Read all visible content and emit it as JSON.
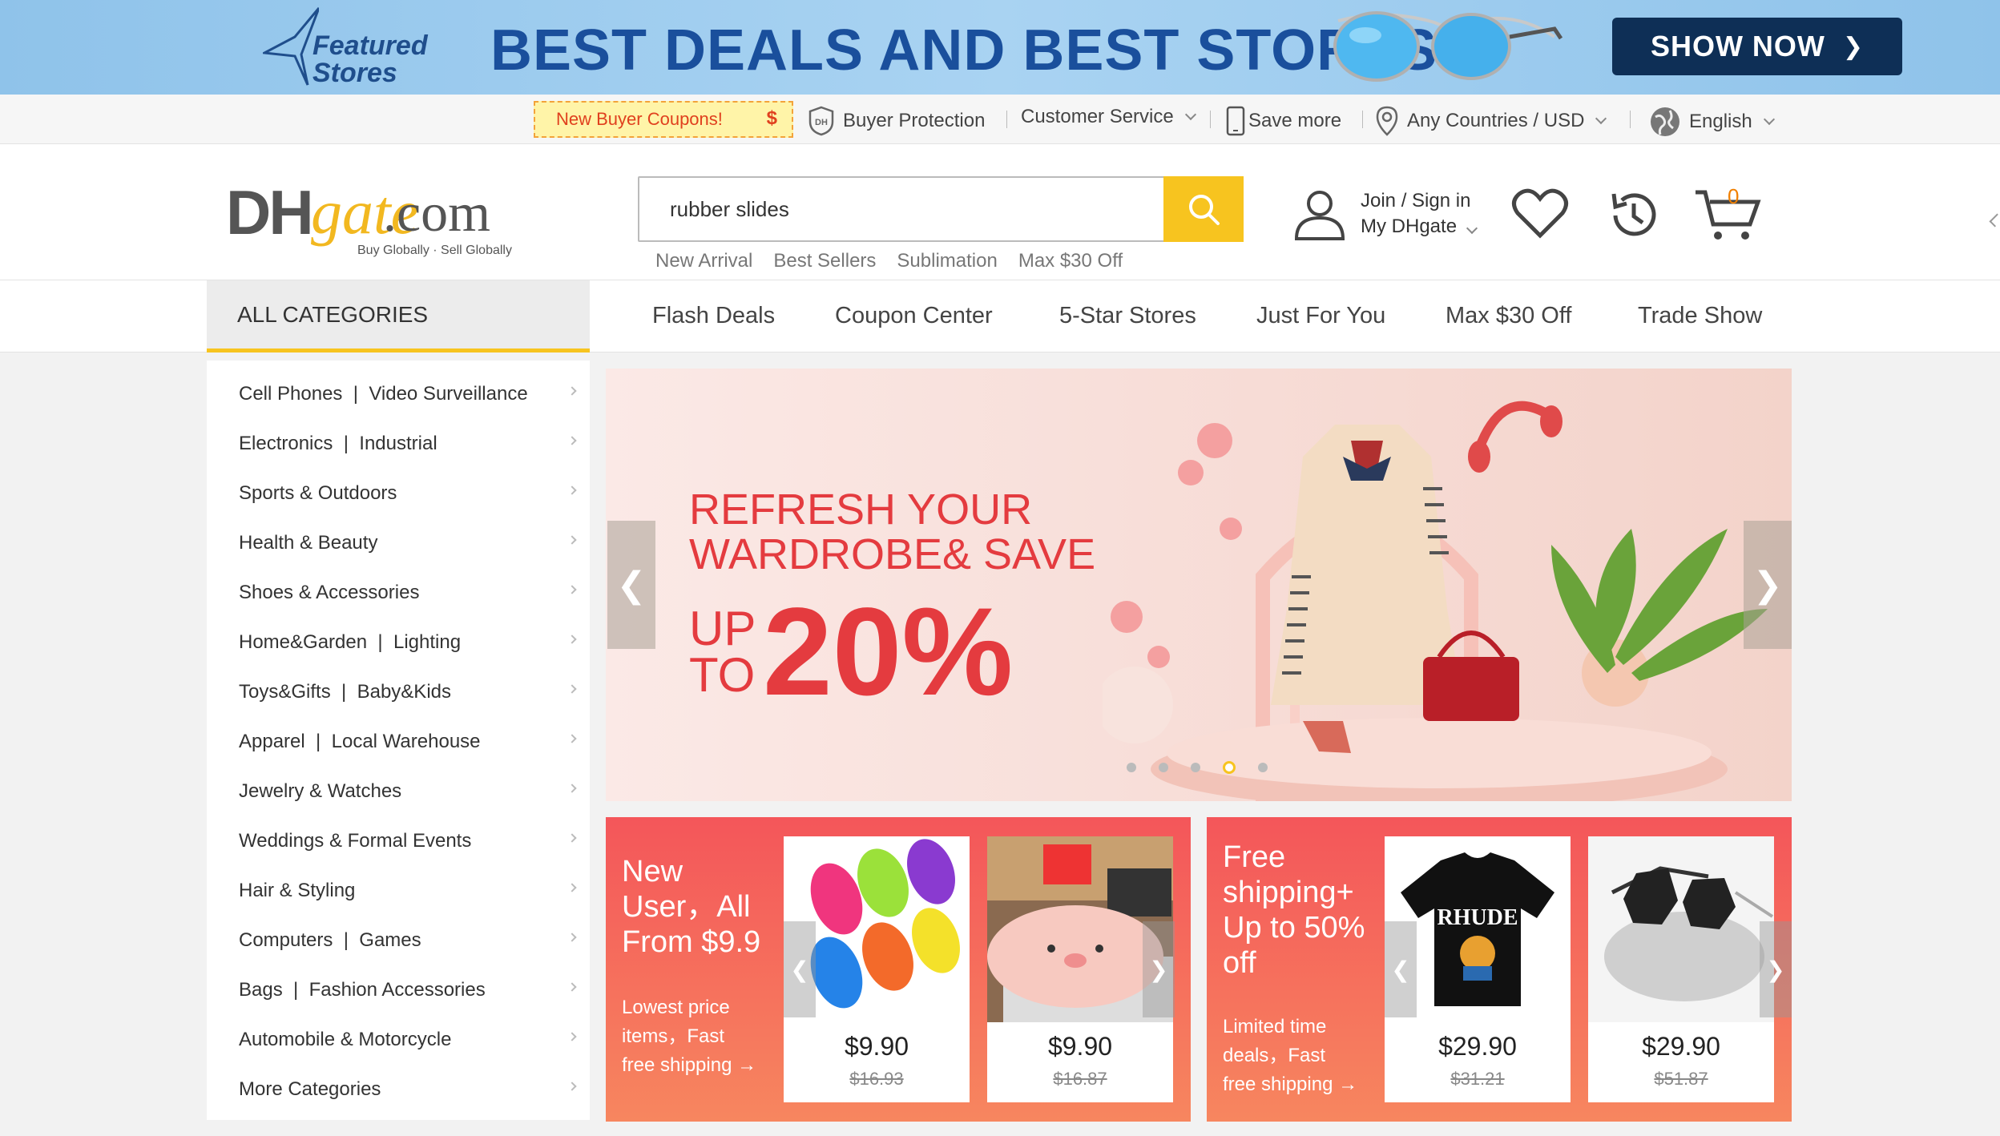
{
  "banner": {
    "featured_line1": "Featured",
    "featured_line2": "Stores",
    "title": "BEST DEALS AND BEST STORES",
    "cta": "SHOW NOW",
    "cta_icon": "chevron-right-icon"
  },
  "utility": {
    "coupon": "New Buyer Coupons!",
    "coupon_symbol": "$",
    "buyer_protection": "Buyer Protection",
    "customer_service": "Customer Service",
    "save_more": "Save more",
    "region": "Any Countries / USD",
    "language": "English"
  },
  "header": {
    "logo_dh": "DH",
    "logo_gate": "gate",
    "logo_com": ".com",
    "logo_tagline": "Buy Globally · Sell Globally",
    "search_value": "rubber slides",
    "hot_links": [
      "New Arrival",
      "Best Sellers",
      "Sublimation",
      "Max $30 Off"
    ],
    "join_sign_in": "Join / Sign in",
    "my_dhgate": "My DHgate",
    "cart_count": "0"
  },
  "nav": {
    "all_categories": "ALL CATEGORIES",
    "items": [
      "Flash Deals",
      "Coupon Center",
      "5-Star Stores",
      "Just For You",
      "Max $30 Off",
      "Trade Show"
    ]
  },
  "categories": [
    "Cell Phones  |  Video Surveillance",
    "Electronics  |  Industrial",
    "Sports & Outdoors",
    "Health & Beauty",
    "Shoes & Accessories",
    "Home&Garden  |  Lighting",
    "Toys&Gifts  |  Baby&Kids",
    "Apparel  |  Local Warehouse",
    "Jewelry & Watches",
    "Weddings & Formal Events",
    "Hair & Styling",
    "Computers  |  Games",
    "Bags  |  Fashion Accessories",
    "Automobile & Motorcycle",
    "More Categories"
  ],
  "hero": {
    "line1": "REFRESH YOUR",
    "line2": "WARDROBE& SAVE",
    "up": "UP",
    "to": "TO",
    "percent": "20%",
    "slide_count": 5,
    "active_slide": 4
  },
  "promo_left": {
    "title_l1": "New",
    "title_l2": "User，All",
    "title_l3": "From $9.9",
    "sub_l1": "Lowest price",
    "sub_l2": "items，Fast",
    "sub_l3": "free shipping →",
    "products": [
      {
        "price": "$9.90",
        "old_price": "$16.93"
      },
      {
        "price": "$9.90",
        "old_price": "$16.87"
      }
    ]
  },
  "promo_right": {
    "title_l1": "Free",
    "title_l2": "shipping+",
    "title_l3": "Up to 50%",
    "title_l4": "off",
    "sub_l1": "Limited time",
    "sub_l2": "deals，Fast",
    "sub_l3": "free shipping →",
    "products": [
      {
        "price": "$29.90",
        "old_price": "$31.21",
        "shirt_text": "RHUDE"
      },
      {
        "price": "$29.90",
        "old_price": "$51.87"
      }
    ]
  },
  "colors": {
    "accent_yellow": "#f7c41f",
    "banner_blue": "#1a4f9c",
    "promo_red": "#f4565a",
    "hero_red": "#e43b3f"
  }
}
